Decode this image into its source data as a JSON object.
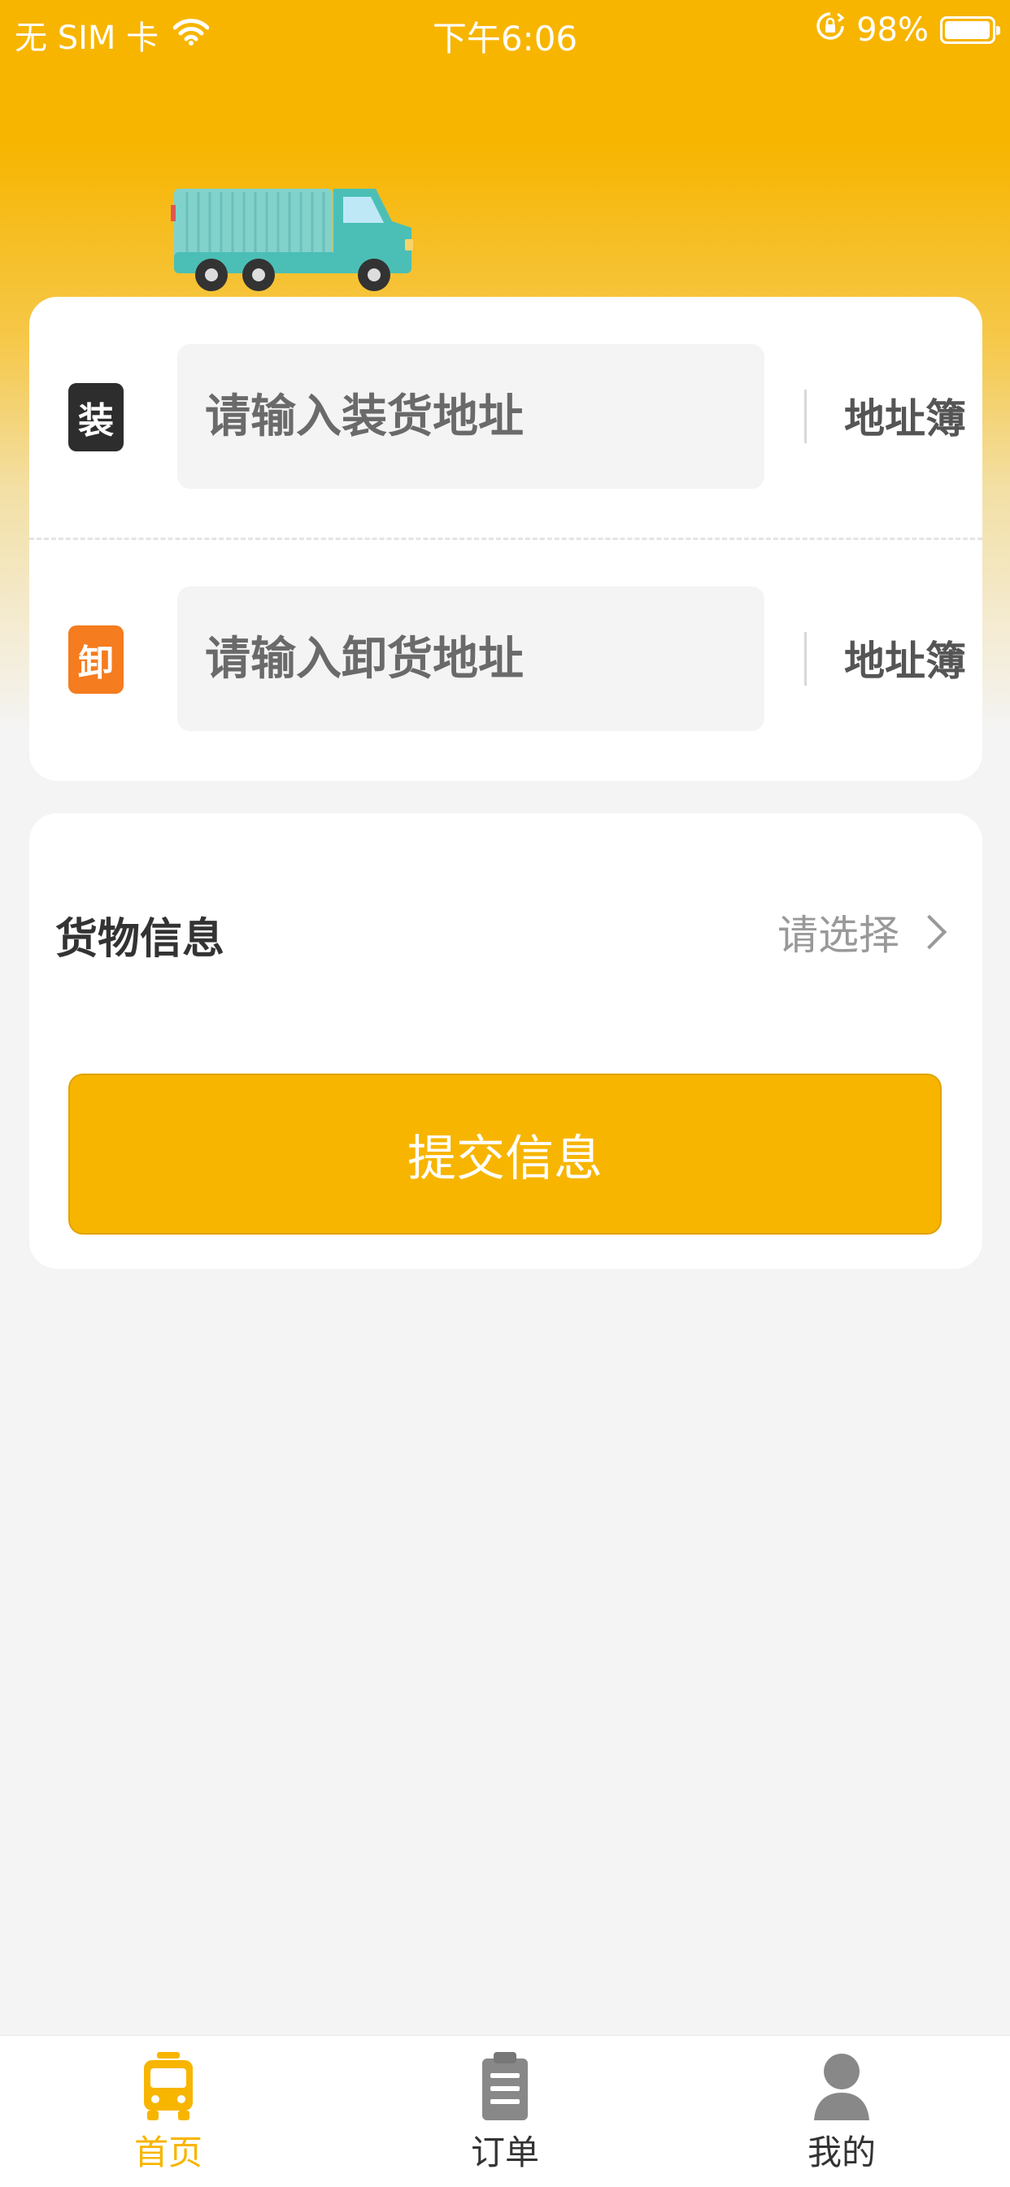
{
  "status_bar": {
    "carrier": "无 SIM 卡",
    "time": "下午6:06",
    "battery": "98%",
    "battery_level": 0.98
  },
  "address": {
    "load": {
      "tag": "装",
      "placeholder": "请输入装货地址",
      "book": "地址簿"
    },
    "unload": {
      "tag": "卸",
      "placeholder": "请输入卸货地址",
      "book": "地址簿"
    }
  },
  "goods": {
    "label": "货物信息",
    "select": "请选择"
  },
  "submit_label": "提交信息",
  "tabbar": {
    "items": [
      {
        "label": "首页",
        "icon": "truck-front-icon",
        "active": true
      },
      {
        "label": "订单",
        "icon": "clipboard-icon",
        "active": false
      },
      {
        "label": "我的",
        "icon": "user-icon",
        "active": false
      }
    ]
  },
  "colors": {
    "accent": "#f7b500",
    "load_tag": "#2d2d2d",
    "unload_tag": "#f57c1f",
    "truck": "#4bbfb6"
  }
}
